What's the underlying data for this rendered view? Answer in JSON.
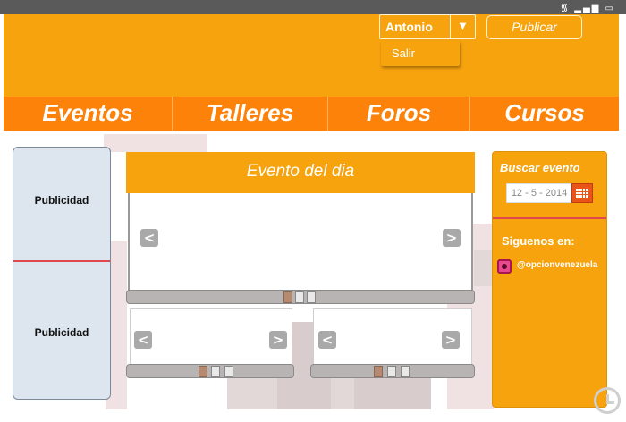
{
  "status_bar": {
    "icons": "wifi-icon signal-icon battery-icon"
  },
  "header": {
    "user_select_value": "Antonio",
    "dropdown_item": "Salir",
    "publish_label": "Publicar"
  },
  "nav": {
    "items": [
      "Eventos",
      "Talleres",
      "Foros",
      "Cursos"
    ]
  },
  "ads": {
    "top_label": "Publicidad",
    "bottom_label": "Publicidad"
  },
  "event": {
    "title": "Evento del dia",
    "prev_label": "<",
    "next_label": ">"
  },
  "side": {
    "search_title": "Buscar evento",
    "date_value": "12 - 5 - 2014",
    "follow_title": "Siguenos en:",
    "instagram_handle": "@opcionvenezuela"
  },
  "colors": {
    "header_orange": "#f7a30e",
    "nav_orange": "#fc8209",
    "divider_red": "#e0484d",
    "calendar_orange": "#e8541a"
  }
}
